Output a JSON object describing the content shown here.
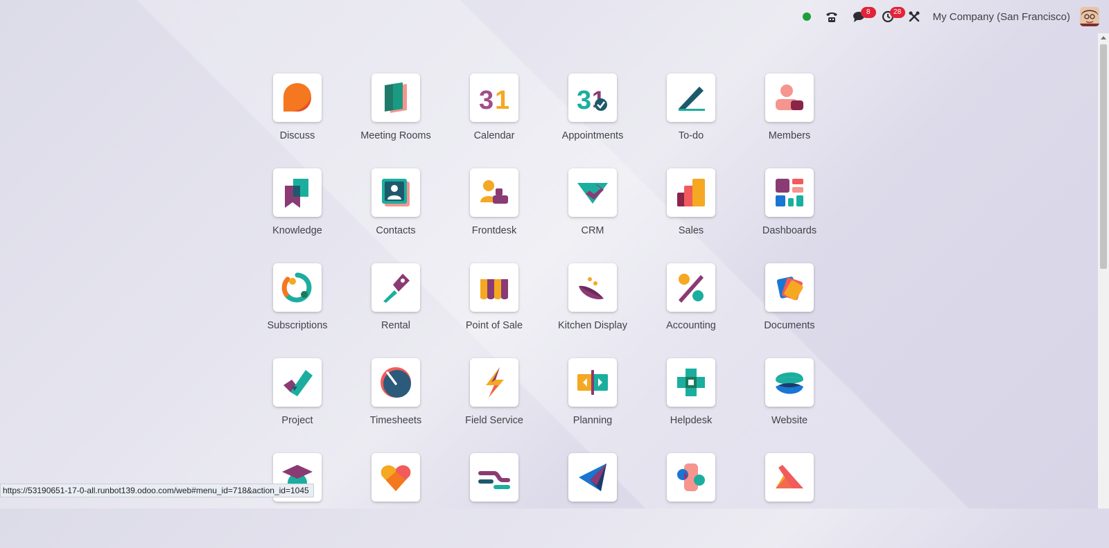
{
  "topbar": {
    "company": "My Company (San Francisco)",
    "messages_count": "8",
    "activities_count": "28"
  },
  "apps": [
    {
      "label": "Discuss",
      "icon": "discuss-icon"
    },
    {
      "label": "Meeting Rooms",
      "icon": "meeting-rooms-icon"
    },
    {
      "label": "Calendar",
      "icon": "calendar-icon"
    },
    {
      "label": "Appointments",
      "icon": "appointments-icon"
    },
    {
      "label": "To-do",
      "icon": "todo-icon"
    },
    {
      "label": "Members",
      "icon": "members-icon"
    },
    {
      "label": "Knowledge",
      "icon": "knowledge-icon"
    },
    {
      "label": "Contacts",
      "icon": "contacts-icon"
    },
    {
      "label": "Frontdesk",
      "icon": "frontdesk-icon"
    },
    {
      "label": "CRM",
      "icon": "crm-icon"
    },
    {
      "label": "Sales",
      "icon": "sales-icon"
    },
    {
      "label": "Dashboards",
      "icon": "dashboards-icon"
    },
    {
      "label": "Subscriptions",
      "icon": "subscriptions-icon"
    },
    {
      "label": "Rental",
      "icon": "rental-icon"
    },
    {
      "label": "Point of Sale",
      "icon": "point-of-sale-icon"
    },
    {
      "label": "Kitchen Display",
      "icon": "kitchen-display-icon"
    },
    {
      "label": "Accounting",
      "icon": "accounting-icon"
    },
    {
      "label": "Documents",
      "icon": "documents-icon"
    },
    {
      "label": "Project",
      "icon": "project-icon"
    },
    {
      "label": "Timesheets",
      "icon": "timesheets-icon"
    },
    {
      "label": "Field Service",
      "icon": "field-service-icon"
    },
    {
      "label": "Planning",
      "icon": "planning-icon"
    },
    {
      "label": "Helpdesk",
      "icon": "helpdesk-icon"
    },
    {
      "label": "Website",
      "icon": "website-icon"
    },
    {
      "label": "",
      "icon": "elearning-icon"
    },
    {
      "label": "",
      "icon": "appraisal-icon"
    },
    {
      "label": "",
      "icon": "switch-icon"
    },
    {
      "label": "",
      "icon": "email-marketing-icon"
    },
    {
      "label": "",
      "icon": "social-icon"
    },
    {
      "label": "",
      "icon": "sign-icon"
    }
  ],
  "status_bar": {
    "url": "https://53190651-17-0-all.runbot139.odoo.com/web#menu_id=718&action_id=1045"
  }
}
